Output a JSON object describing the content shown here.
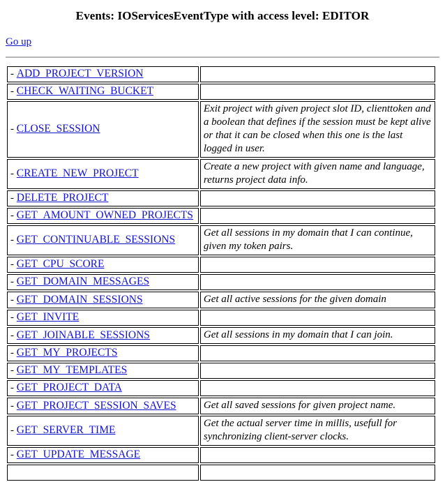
{
  "header": {
    "title": "Events: IOServicesEventType with access level: EDITOR",
    "go_up_label": "Go up"
  },
  "table": {
    "dash_prefix": "-",
    "rows": [
      {
        "name": "ADD_PROJECT_VERSION",
        "description": ""
      },
      {
        "name": "CHECK_WAITING_BUCKET",
        "description": ""
      },
      {
        "name": "CLOSE_SESSION",
        "description": "Exit project with given project slot ID, clienttoken and a boolean that defines if the session must be kept alive or that it can be closed when this one is the last logged in user."
      },
      {
        "name": "CREATE_NEW_PROJECT",
        "description": "Create a new project with given name and language, returns project data info."
      },
      {
        "name": "DELETE_PROJECT",
        "description": ""
      },
      {
        "name": "GET_AMOUNT_OWNED_PROJECTS",
        "description": ""
      },
      {
        "name": "GET_CONTINUABLE_SESSIONS",
        "description": "Get all sessions in my domain that I can continue, given my token pairs."
      },
      {
        "name": "GET_CPU_SCORE",
        "description": ""
      },
      {
        "name": "GET_DOMAIN_MESSAGES",
        "description": ""
      },
      {
        "name": "GET_DOMAIN_SESSIONS",
        "description": "Get all active sessions for the given domain"
      },
      {
        "name": "GET_INVITE",
        "description": ""
      },
      {
        "name": "GET_JOINABLE_SESSIONS",
        "description": "Get all sessions in my domain that I can join."
      },
      {
        "name": "GET_MY_PROJECTS",
        "description": ""
      },
      {
        "name": "GET_MY_TEMPLATES",
        "description": ""
      },
      {
        "name": "GET_PROJECT_DATA",
        "description": ""
      },
      {
        "name": "GET_PROJECT_SESSION_SAVES",
        "description": "Get all saved sessions for given project name."
      },
      {
        "name": "GET_SERVER_TIME",
        "description": "Get the actual server time in millis, usefull for synchronizing client-server clocks."
      },
      {
        "name": "GET_UPDATE_MESSAGE",
        "description": ""
      },
      {
        "name": "",
        "description": ""
      }
    ]
  },
  "colors": {
    "link": "#1414cc",
    "border": "#000000",
    "rule": "#b5b5b5",
    "text": "#000000",
    "background": "#ffffff"
  }
}
